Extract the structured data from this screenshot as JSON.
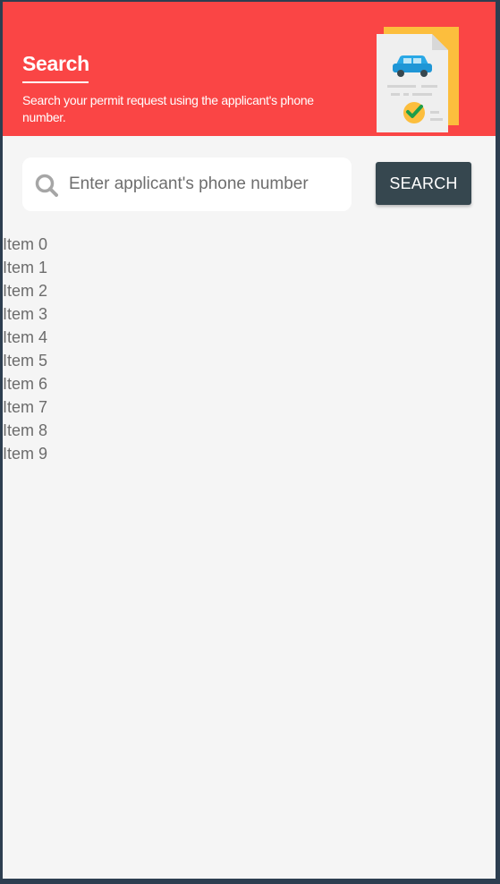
{
  "header": {
    "title": "Search",
    "subtitle": "Search your permit request using the applicant's phone number.",
    "illustration_icon": "car-permit-document-icon",
    "background_color": "#fa4545"
  },
  "search": {
    "placeholder": "Enter applicant's phone number",
    "value": "",
    "button_label": "SEARCH",
    "icon": "search-icon",
    "button_color": "#36474f"
  },
  "results": {
    "items": [
      "Item 0",
      "Item 1",
      "Item 2",
      "Item 3",
      "Item 4",
      "Item 5",
      "Item 6",
      "Item 7",
      "Item 8",
      "Item 9"
    ]
  }
}
